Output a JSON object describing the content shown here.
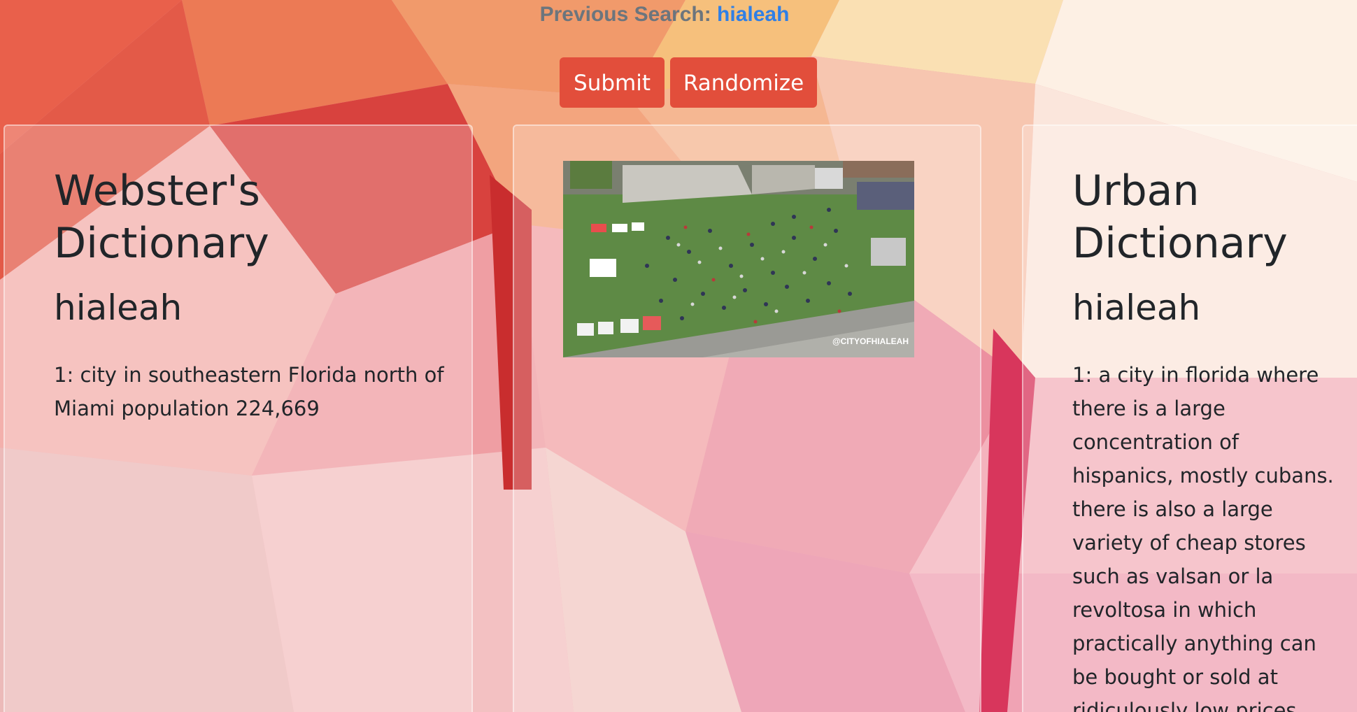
{
  "header": {
    "previous_search_label": "Previous Search:",
    "previous_search_query": "hialeah"
  },
  "actions": {
    "submit_label": "Submit",
    "randomize_label": "Randomize"
  },
  "webster": {
    "title": "Webster's Dictionary",
    "term": "hialeah",
    "definition": "1: city in southeastern Florida north of Miami population 224,669"
  },
  "image": {
    "watermark": "@CITYOFHIALEAH"
  },
  "urban": {
    "title": "Urban Dictionary",
    "term": "hialeah",
    "definition": "1: a city in florida where there is a large concentration of hispanics, mostly cubans. there is also a large variety of cheap stores such as valsan or la revoltosa in which practically anything can be bought or sold at ridiculously low prices."
  },
  "colors": {
    "button": "#e24e3b",
    "link": "#2f7fe6",
    "muted_text": "#6c757d",
    "body_text": "#212529"
  }
}
